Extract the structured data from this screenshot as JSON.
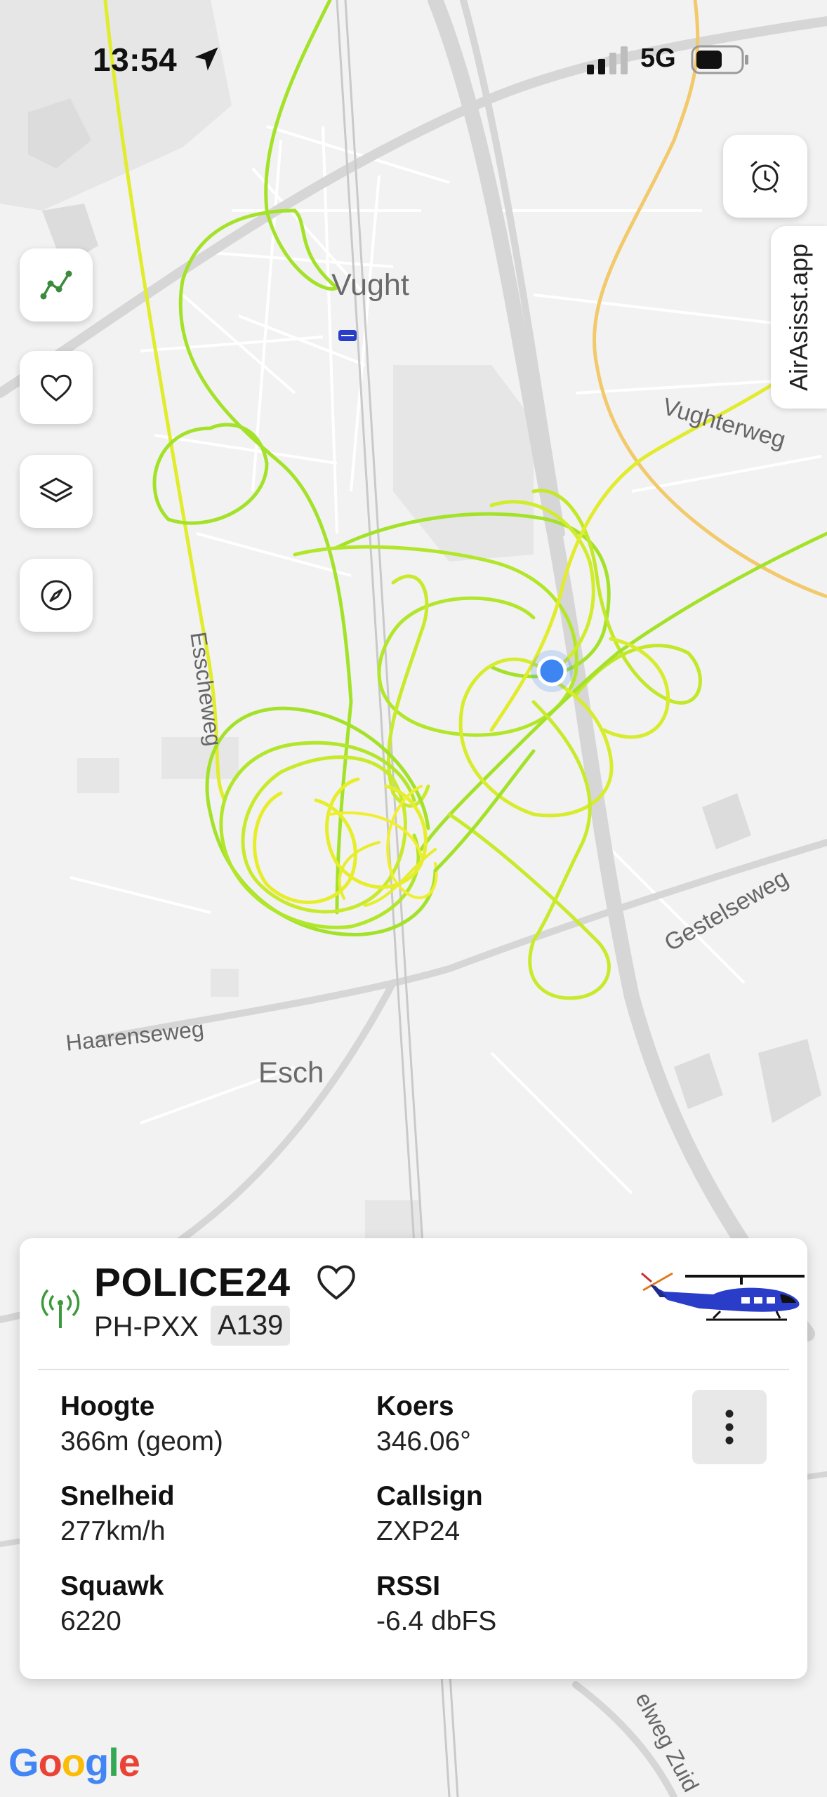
{
  "status_bar": {
    "time": "13:54",
    "network": "5G"
  },
  "side_tab": {
    "label": "AirAsisst.app"
  },
  "map_labels": {
    "vught": "Vught",
    "vughterweg": "Vughterweg",
    "esscheweg": "Esscheweg",
    "gestelseweg": "Gestelseweg",
    "haarenseweg": "Haarenseweg",
    "esch": "Esch",
    "ringweg_zuid": "elweg Zuid"
  },
  "controls": [
    "route-icon",
    "heart-icon",
    "layers-icon",
    "compass-icon",
    "alarm-clock-icon"
  ],
  "aircraft": {
    "callsign_title": "POLICE24",
    "registration": "PH-PXX",
    "type": "A139",
    "fields": {
      "altitude_label": "Hoogte",
      "altitude_value": "366m (geom)",
      "course_label": "Koers",
      "course_value": "346.06°",
      "speed_label": "Snelheid",
      "speed_value": "277km/h",
      "callsign_label": "Callsign",
      "callsign_value": "ZXP24",
      "squawk_label": "Squawk",
      "squawk_value": "6220",
      "rssi_label": "RSSI",
      "rssi_value": "-6.4 dbFS"
    }
  },
  "attribution": {
    "G": "G",
    "o1": "o",
    "o2": "o",
    "g": "g",
    "l": "l",
    "e": "e"
  },
  "colors": {
    "track_green": "#a4e22a",
    "track_yellow": "#e6ee2c",
    "location_blue": "#3d86f2",
    "accent_green": "#3c8a3c",
    "heli_blue": "#2a3dc8"
  }
}
